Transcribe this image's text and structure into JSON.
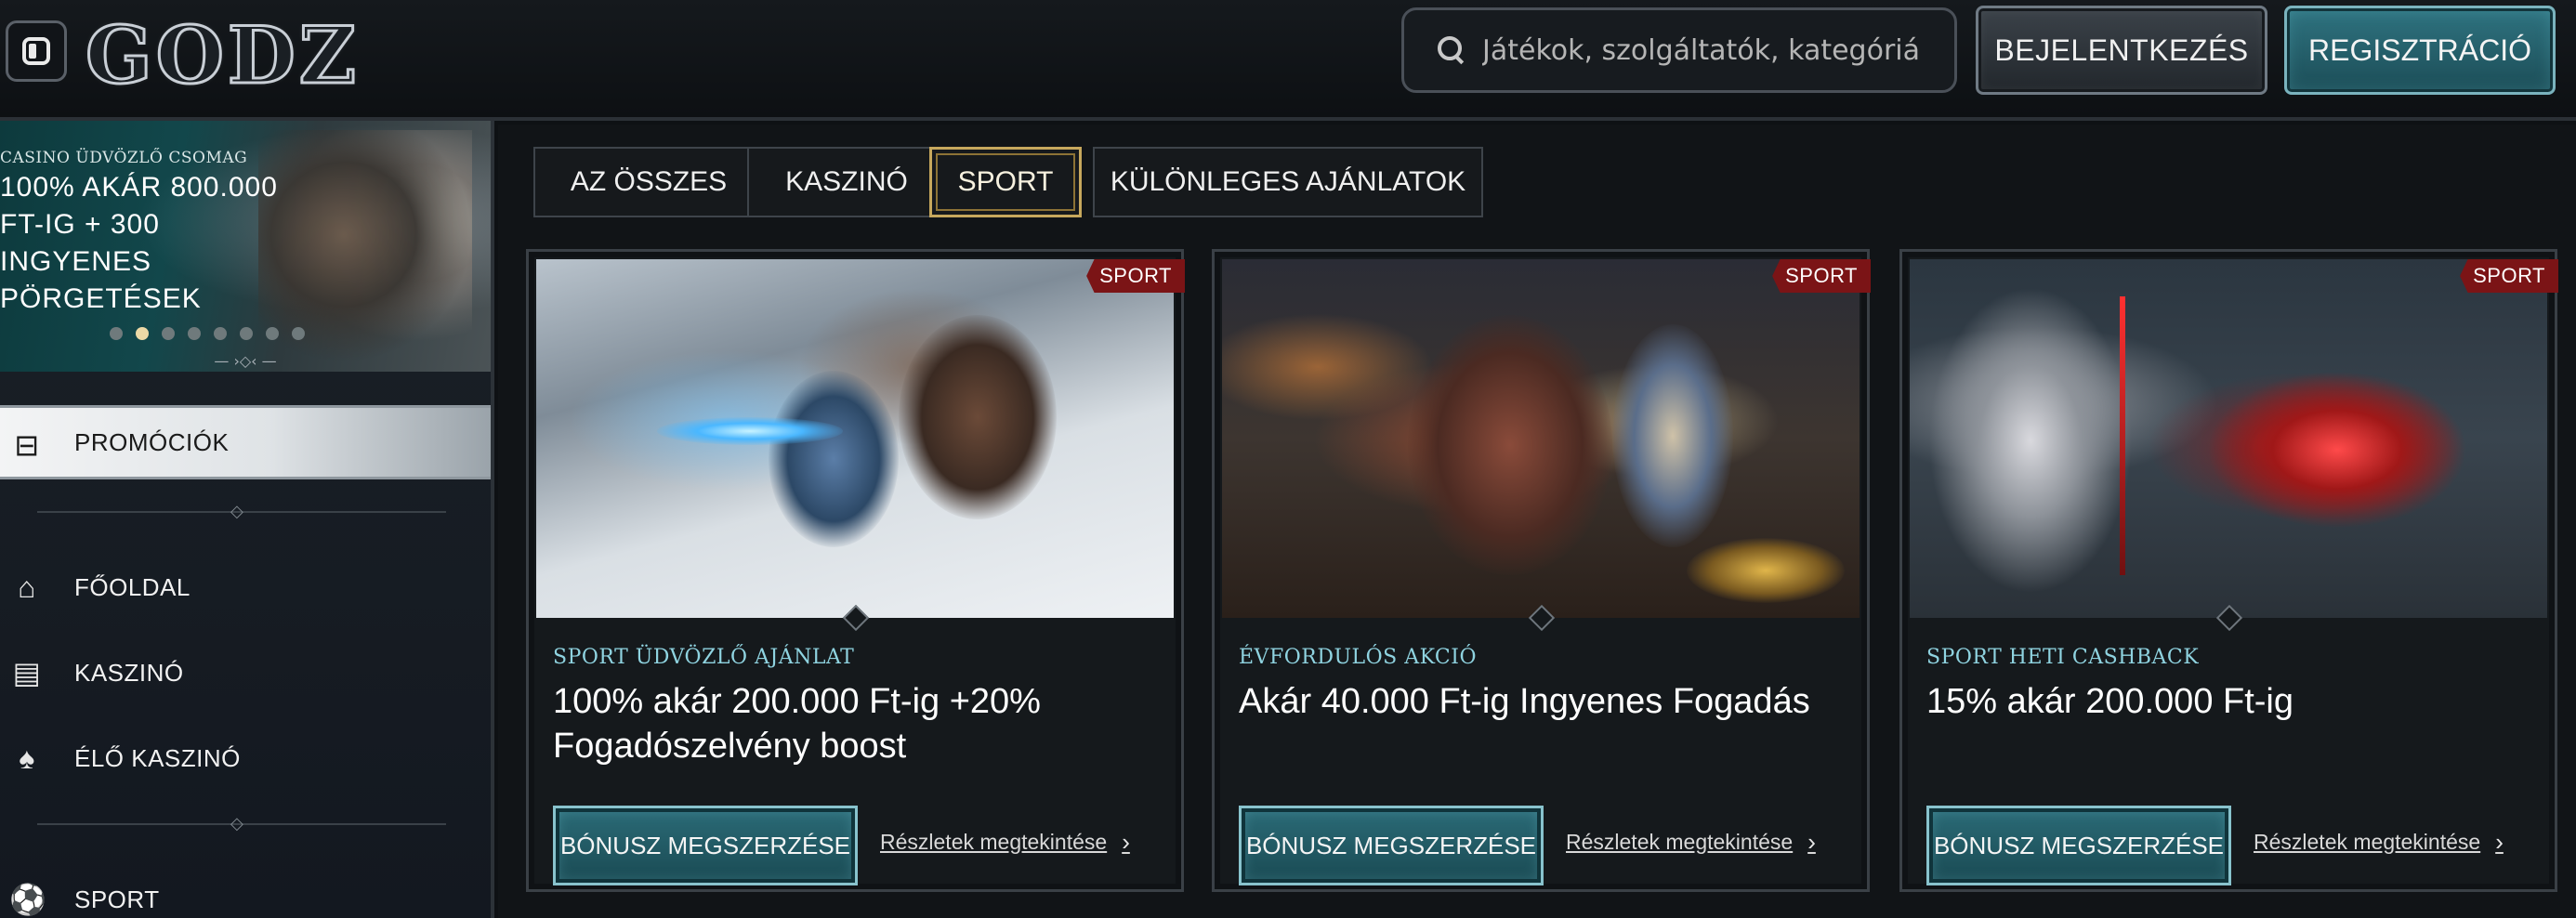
{
  "header": {
    "logo_text": "GODZ",
    "search_placeholder": "Játékok, szolgáltatók, kategóriák k...",
    "login_label": "BEJELENTKEZÉS",
    "register_label": "REGISZTRÁCIÓ",
    "colors": {
      "register": "#2f7380",
      "login": "#3b4249"
    }
  },
  "sidebar": {
    "banner": {
      "kicker": "CASINO ÜDVÖZLŐ CSOMAG",
      "headline": "100% AKÁR 800.000 FT-IG + 300 INGYENES PÖRGETÉSEK",
      "dots_total": 8,
      "dots_active_index": 1
    },
    "items": [
      {
        "label": "PROMÓCIÓK",
        "icon": "treasure-chest-icon",
        "active": true
      },
      {
        "label": "FŐOLDAL",
        "icon": "home-icon",
        "active": false
      },
      {
        "label": "KASZINÓ",
        "icon": "slot-machine-icon",
        "active": false
      },
      {
        "label": "ÉLŐ KASZINÓ",
        "icon": "cards-icon",
        "active": false
      },
      {
        "label": "SPORT",
        "icon": "soccer-ball-icon",
        "active": false
      }
    ]
  },
  "filters": {
    "tabs": [
      {
        "label": "AZ ÖSSZES",
        "active": false
      },
      {
        "label": "KASZINÓ",
        "active": false
      },
      {
        "label": "SPORT",
        "active": true
      },
      {
        "label": "KÜLÖNLEGES AJÁNLATOK",
        "active": false
      }
    ]
  },
  "cards": [
    {
      "badge": "SPORT",
      "kicker": "SPORT ÜDVÖZLŐ AJÁNLAT",
      "title": "100% akár 200.000 Ft-ig +20% Fogadószelvény boost",
      "cta": "BÓNUSZ MEGSZERZÉSE",
      "details": "Részletek megtekintése"
    },
    {
      "badge": "SPORT",
      "kicker": "ÉVFORDULÓS AKCIÓ",
      "title": "Akár 40.000 Ft-ig Ingyenes Fogadás",
      "cta": "BÓNUSZ MEGSZERZÉSE",
      "details": "Részletek megtekintése"
    },
    {
      "badge": "SPORT",
      "kicker": "SPORT HETI CASHBACK",
      "title": "15% akár 200.000 Ft-ig",
      "cta": "BÓNUSZ MEGSZERZÉSE",
      "details": "Részletek megtekintése"
    }
  ],
  "colors": {
    "badge": "#7b1416",
    "kicker": "#8fd3e0",
    "active_tab_border": "#c7a85d",
    "cta": "#2b6b77"
  }
}
